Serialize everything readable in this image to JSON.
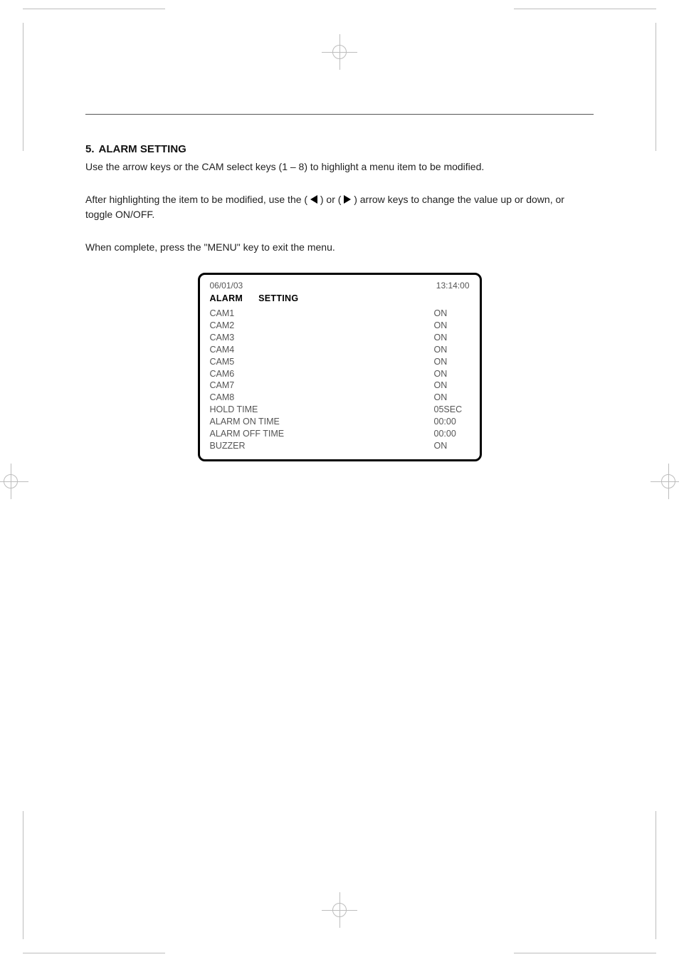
{
  "section": {
    "number": "5.",
    "title": "ALARM SETTING"
  },
  "para1_a": "Use the arrow keys or the CAM select keys (1 – 8) to highlight a menu item to be modified.",
  "para2_a": "After highlighting the item to be modified, use the (",
  "para2_b": ") or (",
  "para2_c": ") arrow keys to change the value up or down, or toggle ON/OFF.",
  "para3": "When complete, press the \"MENU\" key to exit the menu.",
  "menu": {
    "date": "06/01/03",
    "time": "13:14:00",
    "title_a": "ALARM",
    "title_b": "SETTING",
    "rows": [
      {
        "label": "CAM1",
        "value": "ON"
      },
      {
        "label": "CAM2",
        "value": "ON"
      },
      {
        "label": "CAM3",
        "value": "ON"
      },
      {
        "label": "CAM4",
        "value": "ON"
      },
      {
        "label": "CAM5",
        "value": "ON"
      },
      {
        "label": "CAM6",
        "value": "ON"
      },
      {
        "label": "CAM7",
        "value": "ON"
      },
      {
        "label": "CAM8",
        "value": "ON"
      },
      {
        "label": "HOLD TIME",
        "value": "05SEC"
      },
      {
        "label": "ALARM ON TIME",
        "value": "00:00"
      },
      {
        "label": "ALARM OFF TIME",
        "value": "00:00"
      },
      {
        "label": "BUZZER",
        "value": "ON"
      }
    ]
  }
}
